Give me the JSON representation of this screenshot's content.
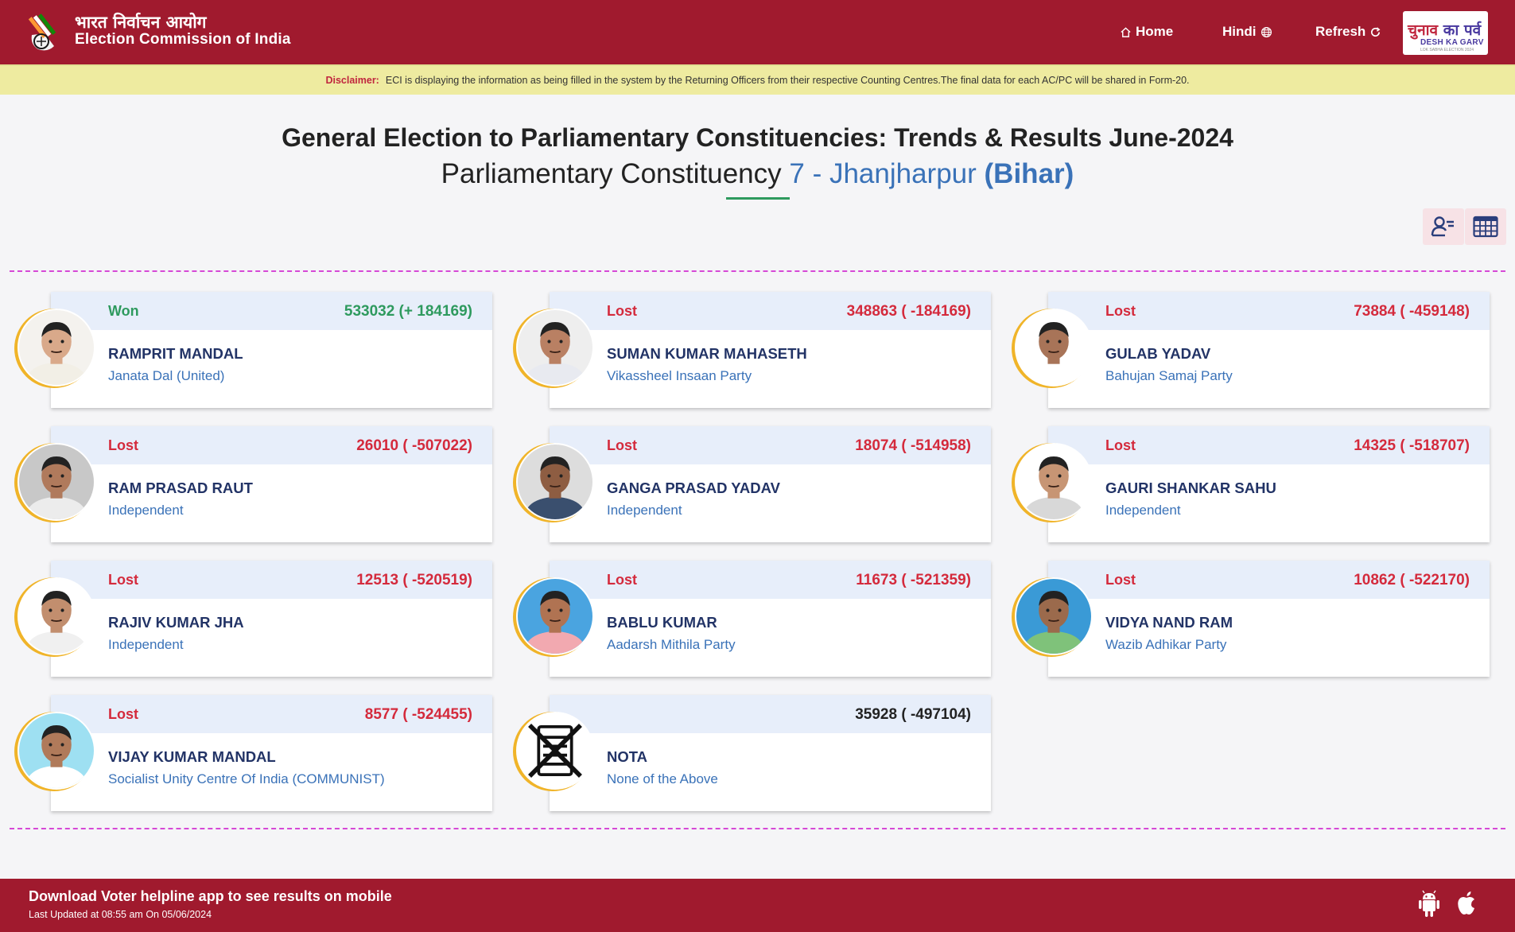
{
  "header": {
    "brand_hindi": "भारत निर्वाचन आयोग",
    "brand_english": "Election Commission of India",
    "nav": {
      "home": "Home",
      "hindi": "Hindi",
      "refresh": "Refresh"
    },
    "badge": {
      "hindi_part1": "चुनाव",
      "hindi_part2": "का पर्व",
      "english": "DESH KA GARV",
      "small": "LOK SABHA ELECTION 2024"
    }
  },
  "disclaimer": {
    "label": "Disclaimer:",
    "text": "ECI is displaying the information as being filled in the system by the Returning Officers from their respective Counting Centres.The final data for each AC/PC will be shared in Form-20."
  },
  "title": {
    "line1": "General Election to Parliamentary Constituencies: Trends & Results June-2024",
    "line2_prefix": "Parliamentary Constituency",
    "constituency": "7 - Jhanjharpur",
    "state": "(Bihar)"
  },
  "candidates": [
    {
      "status": "Won",
      "votes": "533032 (+ 184169)",
      "name": "RAMPRIT MANDAL",
      "party": "Janata Dal (United)",
      "skin": "#d9a98a",
      "shirt": "#f2efe6",
      "bg": "#f4f2ee"
    },
    {
      "status": "Lost",
      "votes": "348863 ( -184169)",
      "name": "SUMAN KUMAR MAHASETH",
      "party": "Vikassheel Insaan Party",
      "skin": "#b98063",
      "shirt": "#e8eaf0",
      "bg": "#eeeeee"
    },
    {
      "status": "Lost",
      "votes": "73884 ( -459148)",
      "name": "GULAB YADAV",
      "party": "Bahujan Samaj Party",
      "skin": "#a87458",
      "shirt": "#ffffff",
      "bg": "#ffffff"
    },
    {
      "status": "Lost",
      "votes": "26010 ( -507022)",
      "name": "RAM PRASAD RAUT",
      "party": "Independent",
      "skin": "#b07a5c",
      "shirt": "#ececec",
      "bg": "#c8c8c8"
    },
    {
      "status": "Lost",
      "votes": "18074 ( -514958)",
      "name": "GANGA PRASAD YADAV",
      "party": "Independent",
      "skin": "#8e5d42",
      "shirt": "#3a4f6e",
      "bg": "#dddddd"
    },
    {
      "status": "Lost",
      "votes": "14325 ( -518707)",
      "name": "GAURI SHANKAR SAHU",
      "party": "Independent",
      "skin": "#c79574",
      "shirt": "#d8d8d8",
      "bg": "#ffffff"
    },
    {
      "status": "Lost",
      "votes": "12513 ( -520519)",
      "name": "RAJIV KUMAR JHA",
      "party": "Independent",
      "skin": "#c28e6e",
      "shirt": "#f0f0f0",
      "bg": "#ffffff"
    },
    {
      "status": "Lost",
      "votes": "11673 ( -521359)",
      "name": "BABLU KUMAR",
      "party": "Aadarsh Mithila Party",
      "skin": "#b07352",
      "shirt": "#f2a9b0",
      "bg": "#4aa4e0"
    },
    {
      "status": "Lost",
      "votes": "10862 ( -522170)",
      "name": "VIDYA NAND RAM",
      "party": "Wazib Adhikar Party",
      "skin": "#9b6a4c",
      "shirt": "#7fc27a",
      "bg": "#3a9ad6"
    },
    {
      "status": "Lost",
      "votes": "8577 ( -524455)",
      "name": "VIJAY KUMAR MANDAL",
      "party": "Socialist Unity Centre Of India (COMMUNIST)",
      "skin": "#b07a5a",
      "shirt": "#ffffff",
      "bg": "#9ee0f2"
    },
    {
      "status": "",
      "votes": "35928 ( -497104)",
      "name": "NOTA",
      "party": "None of the Above",
      "nota": true
    }
  ],
  "footer": {
    "line1": "Download Voter helpline app to see results on mobile",
    "line2": "Last Updated at 08:55 am On 05/06/2024"
  },
  "colors": {
    "brand": "#a01a2e",
    "won": "#2e9a5e",
    "lost": "#d42a3c",
    "link": "#3a72b8",
    "ring": "#f0b429"
  }
}
